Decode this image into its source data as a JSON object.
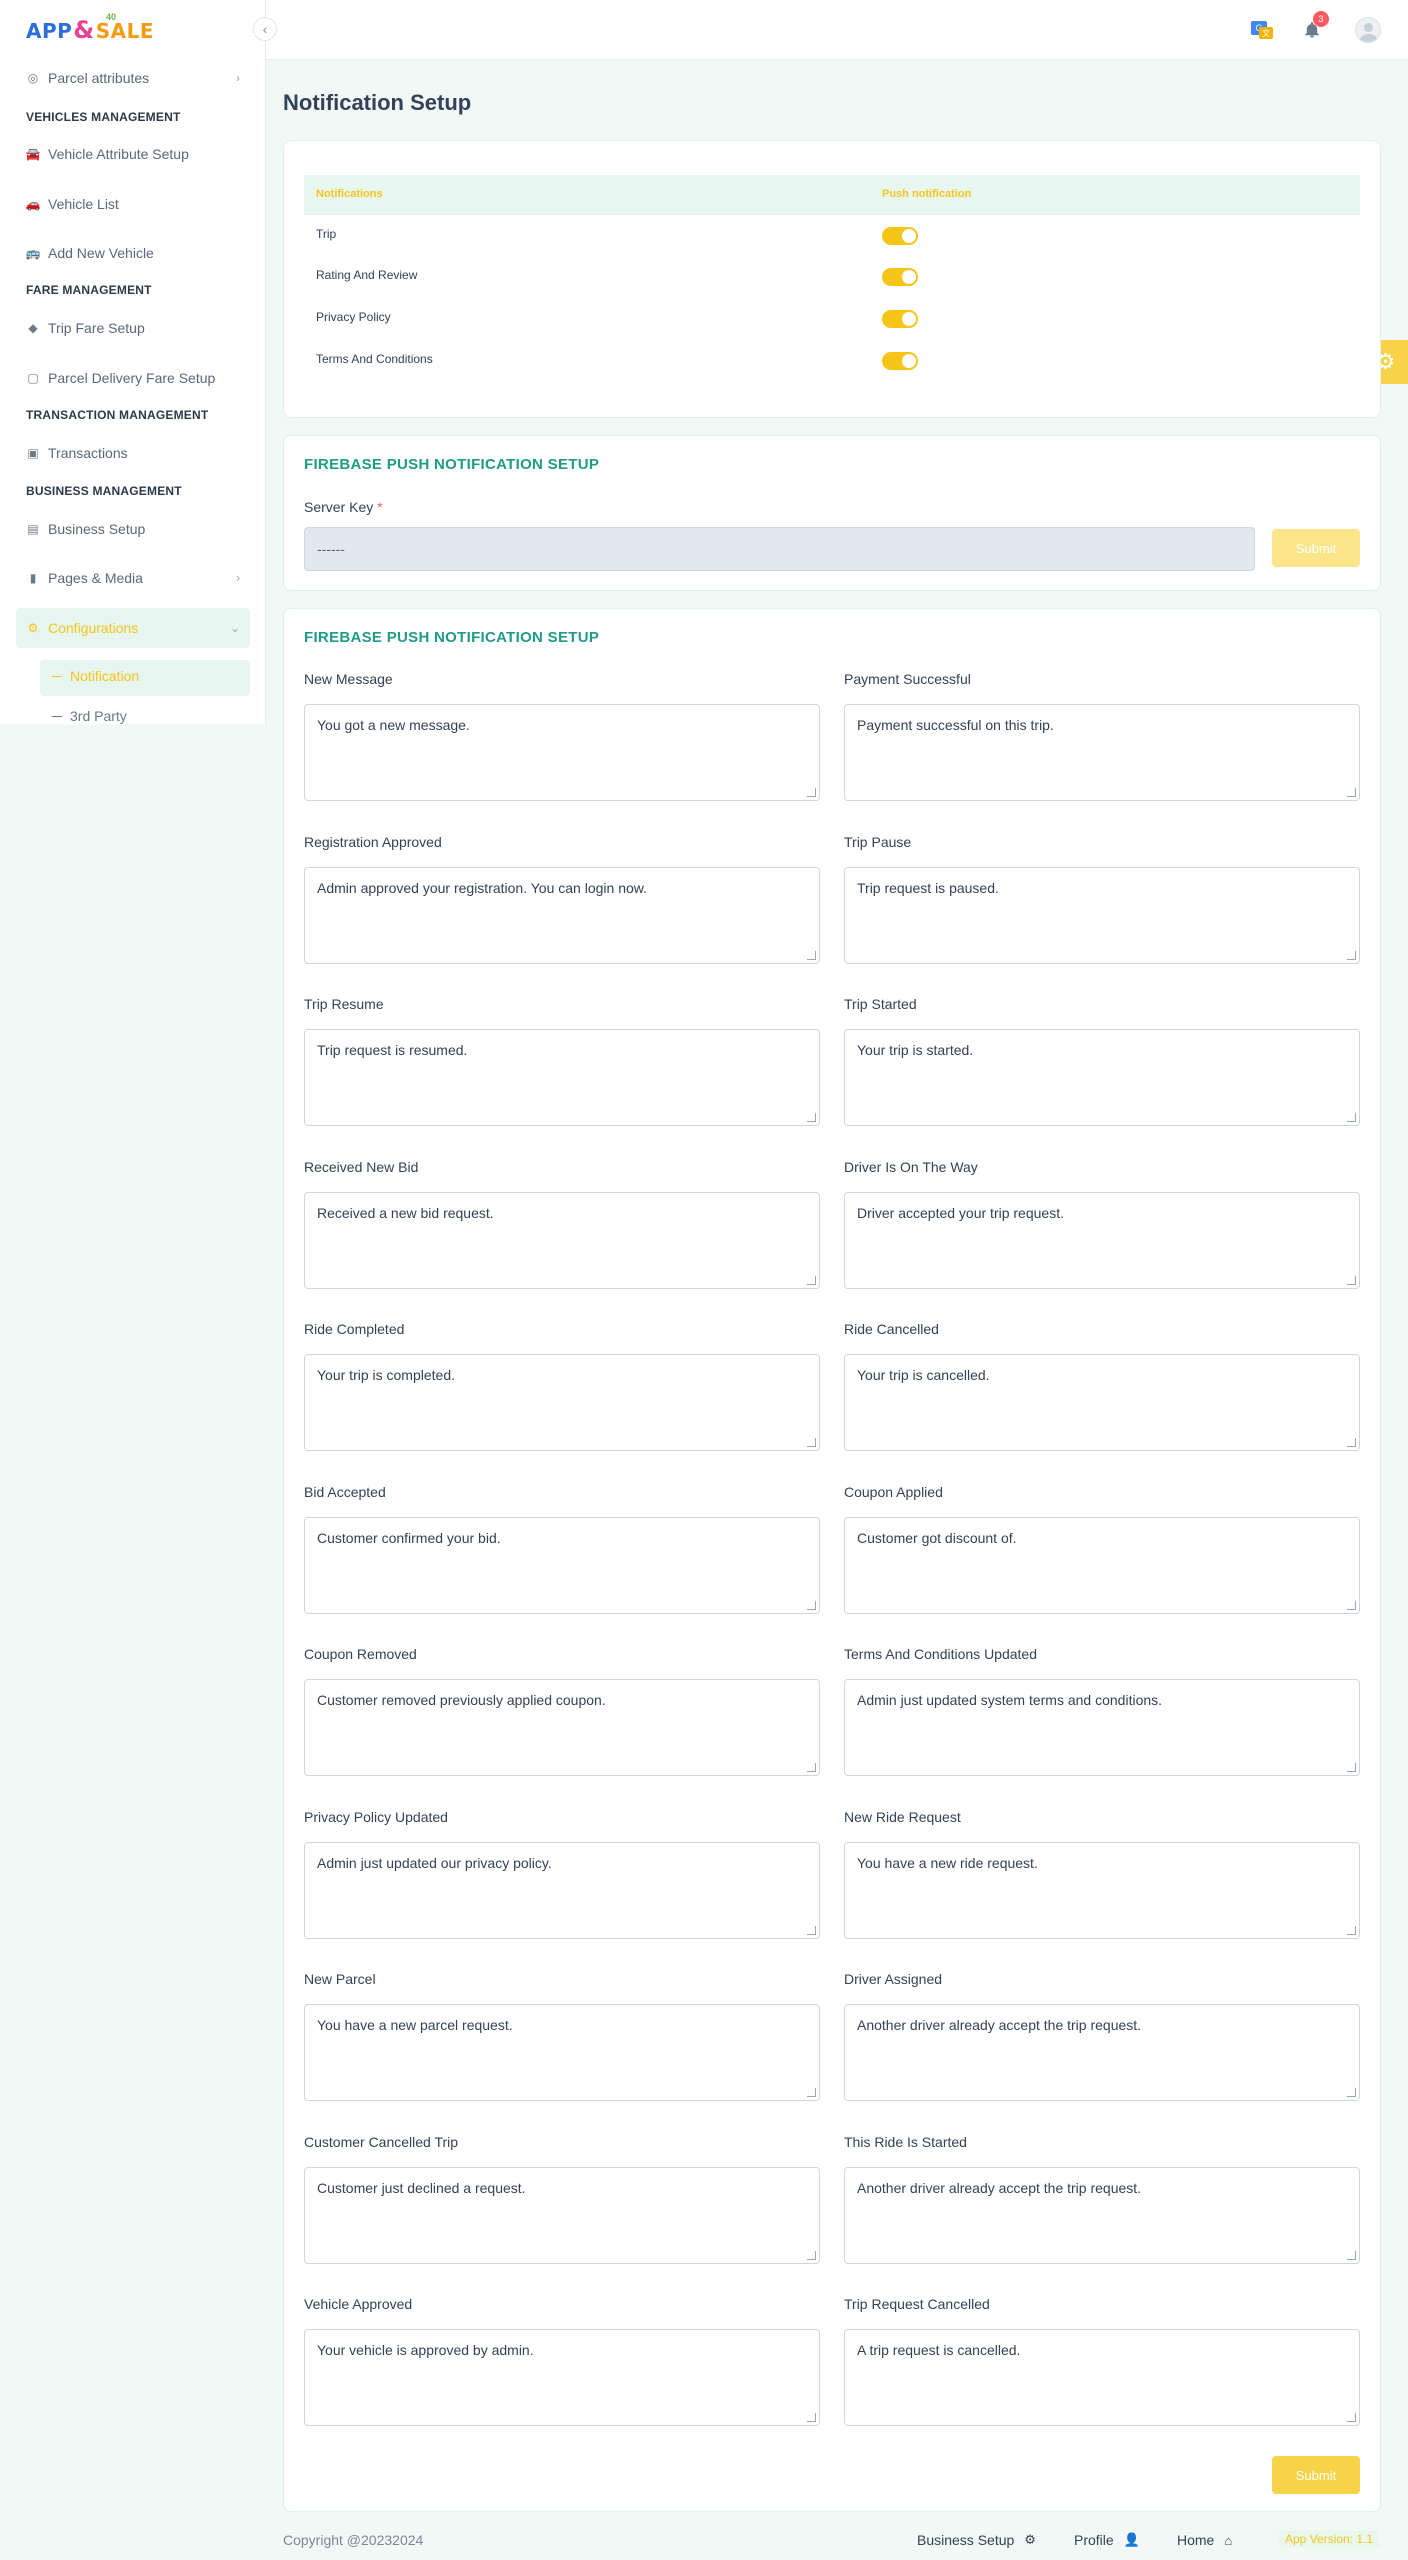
{
  "brand": {
    "part1": "APP",
    "part2": "&",
    "part3": "SALE",
    "tiny": "40"
  },
  "sidebar": {
    "items_top": [
      {
        "label": "Parcel attributes",
        "icon": "circle-icon"
      }
    ],
    "groups": [
      {
        "heading": "VEHICLES MANAGEMENT",
        "items": [
          {
            "label": "Vehicle Attribute Setup"
          },
          {
            "label": "Vehicle List"
          },
          {
            "label": "Add New Vehicle"
          }
        ]
      },
      {
        "heading": "FARE MANAGEMENT",
        "items": [
          {
            "label": "Trip Fare Setup"
          },
          {
            "label": "Parcel Delivery Fare Setup"
          }
        ]
      },
      {
        "heading": "TRANSACTION MANAGEMENT",
        "items": [
          {
            "label": "Transactions"
          }
        ]
      },
      {
        "heading": "BUSINESS MANAGEMENT",
        "items": [
          {
            "label": "Business Setup"
          },
          {
            "label": "Pages & Media"
          },
          {
            "label": "Configurations"
          }
        ]
      }
    ],
    "sub_items": [
      {
        "label": "Notification"
      },
      {
        "label": "3rd Party"
      }
    ]
  },
  "topbar": {
    "notification_count": "3"
  },
  "page": {
    "title": "Notification Setup"
  },
  "notifications_table": {
    "headers": [
      "Notifications",
      "Push notification"
    ],
    "rows": [
      {
        "label": "Trip",
        "enabled": true
      },
      {
        "label": "Rating And Review",
        "enabled": true
      },
      {
        "label": "Privacy Policy",
        "enabled": true
      },
      {
        "label": "Terms And Conditions",
        "enabled": true
      }
    ]
  },
  "firebase": {
    "title": "FIREBASE PUSH NOTIFICATION SETUP",
    "server_key_label": "Server Key",
    "required_mark": "*",
    "server_key_value": "------",
    "submit_label": "Submit"
  },
  "messages": {
    "title": "FIREBASE PUSH NOTIFICATION SETUP",
    "submit_label": "Submit",
    "fields": [
      {
        "label": "New Message",
        "value": "You got a new message."
      },
      {
        "label": "Payment Successful",
        "value": "Payment successful on this trip."
      },
      {
        "label": "Registration Approved",
        "value": "Admin approved your registration. You can login now."
      },
      {
        "label": "Trip Pause",
        "value": "Trip request is paused."
      },
      {
        "label": "Trip Resume",
        "value": "Trip request is resumed."
      },
      {
        "label": "Trip Started",
        "value": "Your trip is started."
      },
      {
        "label": "Received New Bid",
        "value": "Received  a new bid request."
      },
      {
        "label": "Driver Is On The Way",
        "value": "Driver accepted your trip request."
      },
      {
        "label": "Ride Completed",
        "value": "Your trip is completed."
      },
      {
        "label": "Ride Cancelled",
        "value": "Your trip is cancelled."
      },
      {
        "label": "Bid Accepted",
        "value": "Customer confirmed your bid."
      },
      {
        "label": "Coupon Applied",
        "value": "Customer got discount of."
      },
      {
        "label": "Coupon Removed",
        "value": "Customer removed previously applied coupon."
      },
      {
        "label": "Terms And Conditions Updated",
        "value": "Admin just updated system terms and conditions."
      },
      {
        "label": "Privacy Policy Updated",
        "value": "Admin  just updated our privacy policy."
      },
      {
        "label": "New Ride Request",
        "value": "You have a new ride request."
      },
      {
        "label": "New Parcel",
        "value": "You have a new parcel request."
      },
      {
        "label": "Driver Assigned",
        "value": "Another driver already accept the trip request."
      },
      {
        "label": "Customer Cancelled Trip",
        "value": "Customer just declined a request."
      },
      {
        "label": "This Ride Is Started",
        "value": "Another driver already accept the trip request."
      },
      {
        "label": "Vehicle Approved",
        "value": "Your vehicle is approved by admin."
      },
      {
        "label": "Trip Request Cancelled",
        "value": "A trip request is cancelled."
      }
    ]
  },
  "footer": {
    "copyright": "Copyright @20232024",
    "links": [
      {
        "label": "Business Setup",
        "icon": "gear-icon"
      },
      {
        "label": "Profile",
        "icon": "user-icon"
      },
      {
        "label": "Home",
        "icon": "home-icon"
      }
    ],
    "version": "App Version: 1.1"
  },
  "colors": {
    "accent": "#f5c518",
    "section_title": "#1f9c87",
    "background": "#f1f8f6"
  }
}
